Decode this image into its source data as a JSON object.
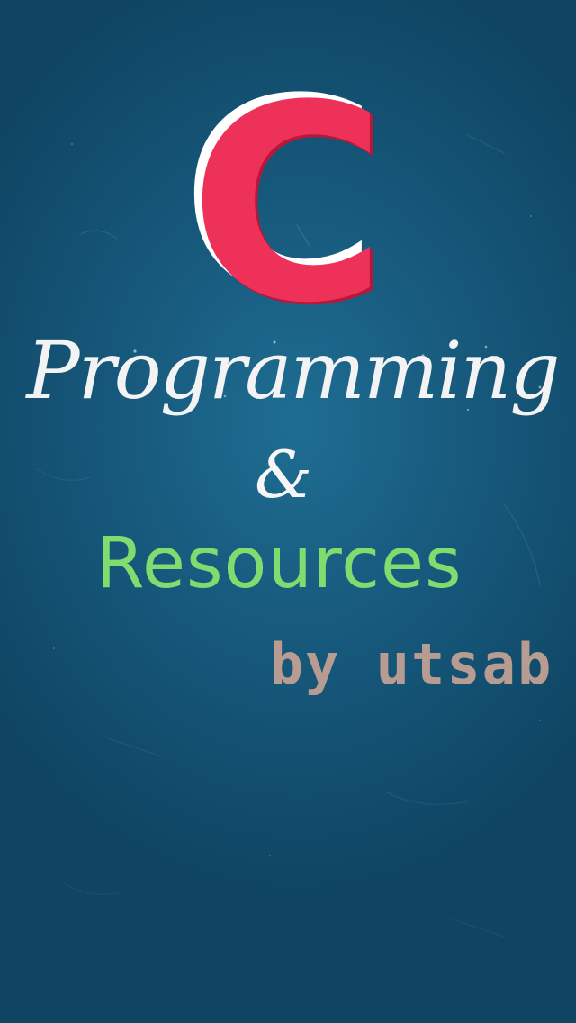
{
  "splash": {
    "letter": "C",
    "line1": "Programming",
    "conjunction": "&",
    "line2": "Resources",
    "byline": "by utsab"
  },
  "colors": {
    "background": "#175a7d",
    "letter": "#ee3158",
    "programming": "#f3f3f3",
    "resources": "#7fdc6e",
    "byline": "#b89b91"
  }
}
